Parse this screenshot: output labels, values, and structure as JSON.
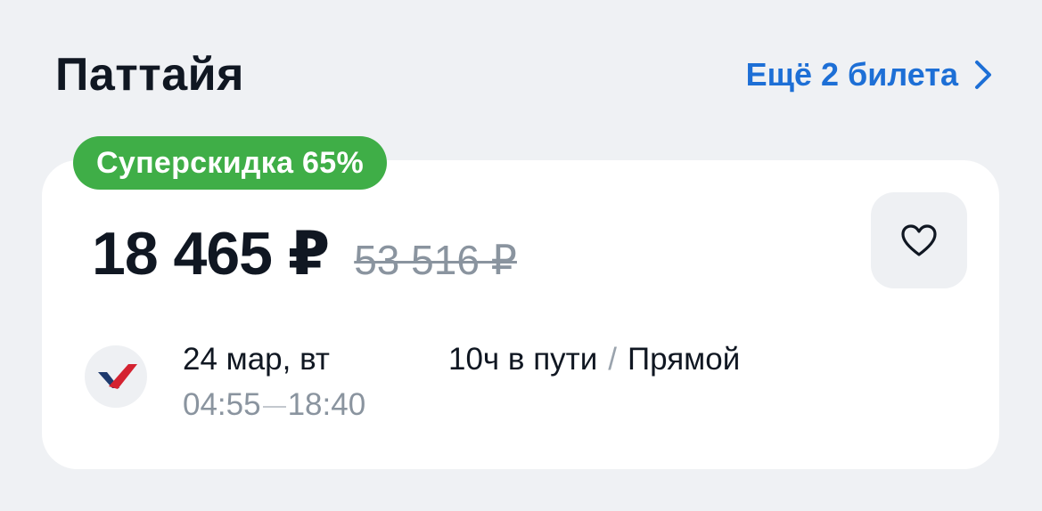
{
  "header": {
    "city": "Паттайя",
    "more_tickets": "Ещё 2 билета"
  },
  "badge": {
    "label": "Суперскидка 65%",
    "color": "#3fae47"
  },
  "price": {
    "current": "18 465 ₽",
    "old": "53 516 ₽"
  },
  "favorite": {
    "icon": "heart-outline-icon"
  },
  "flight": {
    "airline_logo_icon": "airline-logo-icon",
    "date": "24 мар, вт",
    "departure": "04:55",
    "arrival": "18:40",
    "duration": "10ч в пути",
    "separator": "/",
    "type": "Прямой"
  },
  "colors": {
    "background": "#eff1f4",
    "card": "#ffffff",
    "link": "#1d6fd6",
    "text_primary": "#101722",
    "text_secondary": "#8a949f"
  }
}
